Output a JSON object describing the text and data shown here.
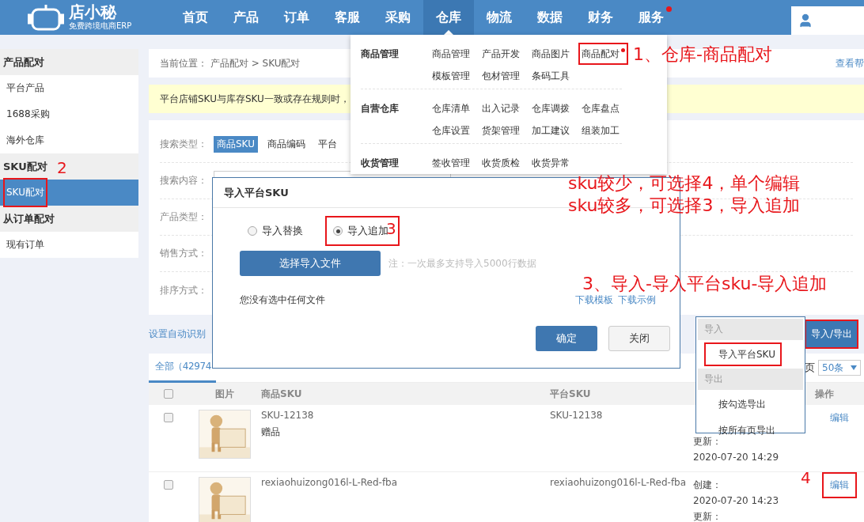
{
  "header": {
    "logo": {
      "name": "店小秘",
      "tagline": "免费跨境电商ERP"
    },
    "nav": [
      {
        "label": "首页",
        "selected": false,
        "dot": false
      },
      {
        "label": "产品",
        "selected": false,
        "dot": false
      },
      {
        "label": "订单",
        "selected": false,
        "dot": false
      },
      {
        "label": "客服",
        "selected": false,
        "dot": false
      },
      {
        "label": "采购",
        "selected": false,
        "dot": false
      },
      {
        "label": "仓库",
        "selected": true,
        "dot": false
      },
      {
        "label": "物流",
        "selected": false,
        "dot": false
      },
      {
        "label": "数据",
        "selected": false,
        "dot": false
      },
      {
        "label": "财务",
        "selected": false,
        "dot": false
      },
      {
        "label": "服务",
        "selected": false,
        "dot": true
      }
    ]
  },
  "sidebar": {
    "groups": [
      {
        "title": "产品配对",
        "items": [
          {
            "label": "平台产品",
            "selected": false,
            "highlighted": false
          },
          {
            "label": "1688采购",
            "selected": false,
            "highlighted": false
          },
          {
            "label": "海外仓库",
            "selected": false,
            "highlighted": false
          }
        ]
      },
      {
        "title": "SKU配对",
        "items": [
          {
            "label": "SKU配对",
            "selected": true,
            "highlighted": true
          }
        ]
      },
      {
        "title": "从订单配对",
        "items": [
          {
            "label": "现有订单",
            "selected": false,
            "highlighted": false
          }
        ]
      }
    ]
  },
  "breadcrumb": {
    "label": "当前位置：",
    "path": "产品配对 > SKU配对",
    "help": "查看帮"
  },
  "notice": "平台店铺SKU与库存SKU一致或存在规则时，",
  "filters": [
    {
      "label": "搜索类型：",
      "kind": "options",
      "options": [
        {
          "label": "商品SKU",
          "selected": true
        },
        {
          "label": "商品编码",
          "selected": false
        },
        {
          "label": "平台",
          "selected": false
        }
      ]
    },
    {
      "label": "搜索内容：",
      "kind": "input"
    },
    {
      "label": "产品类型：",
      "kind": "blank"
    },
    {
      "label": "销售方式：",
      "kind": "blank"
    },
    {
      "label": "排序方式：",
      "kind": "blank"
    }
  ],
  "auto_rule_link": "设置自动识别",
  "import_export_button": {
    "label": "导入/导出",
    "highlighted": true
  },
  "table": {
    "tabs": [
      {
        "label": "全部（42974",
        "selected": true
      }
    ],
    "page_label": "页",
    "page_size": "50条",
    "header_checked": false,
    "columns": [
      "图片",
      "商品SKU",
      "平台SKU",
      "操作"
    ],
    "rows": [
      {
        "checked": false,
        "sku": "SKU-12138",
        "tag": "赠品",
        "platform_sku": "SKU-12138",
        "times": [
          "更新：",
          "2020-07-20 14:29"
        ],
        "action": "编辑",
        "highlighted": false
      },
      {
        "checked": false,
        "sku": "rexiaohuizong016l-L-Red-fba",
        "platform_sku": "rexiaohuizong016l-L-Red-fba",
        "times": [
          "创建：",
          "2020-07-20 14:23",
          "更新："
        ],
        "action": "编辑",
        "highlighted": true
      }
    ]
  },
  "warehouse_menu": {
    "sections": [
      {
        "title": "商品管理",
        "items": [
          {
            "label": "商品管理",
            "dot": false,
            "highlighted": false
          },
          {
            "label": "产品开发",
            "dot": false,
            "highlighted": false
          },
          {
            "label": "商品图片",
            "dot": false,
            "highlighted": false
          },
          {
            "label": "商品配对",
            "dot": true,
            "highlighted": true
          },
          {
            "label": "模板管理",
            "dot": false,
            "highlighted": false
          },
          {
            "label": "包材管理",
            "dot": false,
            "highlighted": false
          },
          {
            "label": "条码工具",
            "dot": false,
            "highlighted": false
          }
        ]
      },
      {
        "title": "自营仓库",
        "items": [
          {
            "label": "仓库清单",
            "dot": false,
            "highlighted": false
          },
          {
            "label": "出入记录",
            "dot": false,
            "highlighted": false
          },
          {
            "label": "仓库调拨",
            "dot": false,
            "highlighted": false
          },
          {
            "label": "仓库盘点",
            "dot": false,
            "highlighted": false
          },
          {
            "label": "仓库设置",
            "dot": false,
            "highlighted": false
          },
          {
            "label": "货架管理",
            "dot": false,
            "highlighted": false
          },
          {
            "label": "加工建议",
            "dot": false,
            "highlighted": false
          },
          {
            "label": "组装加工",
            "dot": false,
            "highlighted": false
          }
        ]
      },
      {
        "title": "收货管理",
        "items": [
          {
            "label": "签收管理",
            "dot": false,
            "highlighted": false
          },
          {
            "label": "收货质检",
            "dot": false,
            "highlighted": false
          },
          {
            "label": "收货异常",
            "dot": false,
            "highlighted": false
          }
        ]
      }
    ]
  },
  "import_dialog": {
    "title": "导入平台SKU",
    "modes": [
      {
        "label": "导入替换",
        "selected": false,
        "highlighted": false
      },
      {
        "label": "导入追加",
        "selected": true,
        "highlighted": true
      }
    ],
    "choose_button": "选择导入文件",
    "note": "注：一次最多支持导入5000行数据",
    "file_status": "您没有选中任何文件",
    "links": [
      "下载模板",
      "下载示例"
    ],
    "confirm": "确定",
    "close": "关闭"
  },
  "import_export_menu": [
    {
      "kind": "group",
      "label": "导入"
    },
    {
      "kind": "item",
      "label": "导入平台SKU",
      "highlighted": true
    },
    {
      "kind": "group",
      "label": "导出"
    },
    {
      "kind": "item",
      "label": "按勾选导出",
      "highlighted": false
    },
    {
      "kind": "item",
      "label": "按所有页导出",
      "highlighted": false
    }
  ],
  "annotations": [
    "1、仓库-商品配对",
    "2",
    "sku较少，可选择4，单个编辑",
    "sku较多，可选择3，导入追加",
    "3",
    "3、导入-导入平台sku-导入追加",
    "4"
  ]
}
